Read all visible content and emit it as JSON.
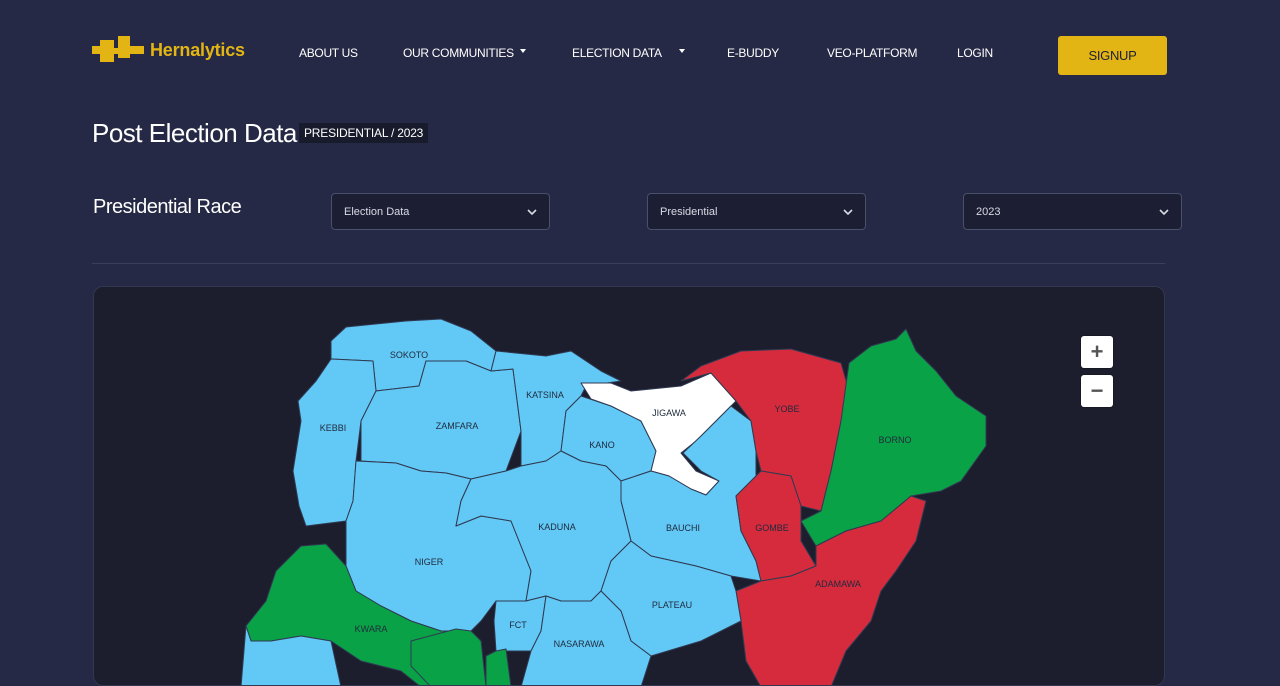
{
  "brand": {
    "name": "Hernalytics",
    "color": "#e3b514"
  },
  "nav": {
    "about": "ABOUT US",
    "communities": "OUR COMMUNITIES",
    "election_data": "ELECTION DATA",
    "ebuddy": "E-BUDDY",
    "veo": "VEO-PLATFORM",
    "login": "LOGIN",
    "signup": "SIGNUP"
  },
  "page": {
    "title": "Post Election Data",
    "badge": "PRESIDENTIAL / 2023",
    "section_title": "Presidential Race"
  },
  "filters": {
    "category": "Election Data",
    "election_type": "Presidential",
    "year": "2023"
  },
  "map": {
    "zoom_in": "+",
    "zoom_out": "−",
    "colors": {
      "blue": "#62c8f5",
      "red": "#d52b3c",
      "green": "#0aa246",
      "white": "#ffffff"
    },
    "states": {
      "sokoto": "SOKOTO",
      "kebbi": "KEBBI",
      "zamfara": "ZAMFARA",
      "katsina": "KATSINA",
      "jigawa": "JIGAWA",
      "kano": "KANO",
      "yobe": "YOBE",
      "borno": "BORNO",
      "kaduna": "KADUNA",
      "bauchi": "BAUCHI",
      "gombe": "GOMBE",
      "niger": "NIGER",
      "adamawa": "ADAMAWA",
      "plateau": "PLATEAU",
      "fct": "FCT",
      "kwara": "KWARA",
      "nasarawa": "NASARAWA"
    }
  }
}
